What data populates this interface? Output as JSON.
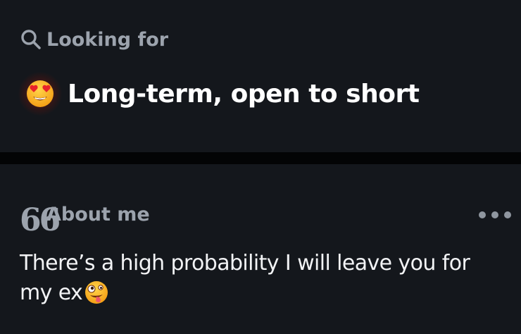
{
  "looking_for": {
    "heading": "Looking for",
    "icon": "search-icon",
    "value_emoji": "heart-eyes-emoji",
    "value": "Long-term, open to short"
  },
  "about_me": {
    "heading": "About me",
    "icon": "quote-icon",
    "quote_glyph": "66",
    "more_icon": "more-options-icon",
    "text": "There’s a high probability I will leave you for my ex",
    "trailing_emoji": "zany-face-emoji"
  },
  "colors": {
    "background": "#030405",
    "card": "#14171c",
    "heading_text": "#9ca3ad",
    "body_text": "#f2f3f5",
    "value_text": "#ffffff"
  }
}
